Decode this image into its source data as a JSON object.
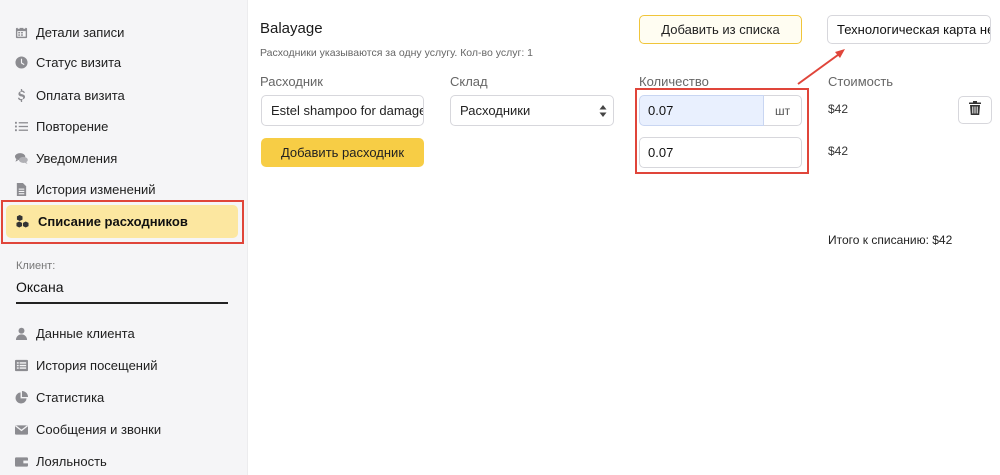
{
  "sidebar": {
    "items": [
      {
        "label": "Детали записи",
        "icon": "calendar-icon"
      },
      {
        "label": "Статус визита",
        "icon": "clock-icon"
      },
      {
        "label": "Оплата визита",
        "icon": "dollar-icon"
      },
      {
        "label": "Повторение",
        "icon": "list-icon"
      },
      {
        "label": "Уведомления",
        "icon": "comments-icon"
      },
      {
        "label": "История изменений",
        "icon": "document-icon"
      }
    ],
    "active": {
      "label": "Списание расходников",
      "icon": "cubes-icon"
    },
    "client_label": "Клиент:",
    "client_name": "Оксана",
    "client_items": [
      {
        "label": "Данные клиента",
        "icon": "user-icon"
      },
      {
        "label": "История посещений",
        "icon": "list-alt-icon"
      },
      {
        "label": "Статистика",
        "icon": "pie-chart-icon"
      },
      {
        "label": "Сообщения и звонки",
        "icon": "envelope-icon"
      },
      {
        "label": "Лояльность",
        "icon": "wallet-icon"
      }
    ]
  },
  "main": {
    "title": "Balayage",
    "subtitle": "Расходники указываются за одну услугу. Кол-во услуг: 1",
    "add_from_list": "Добавить из списка",
    "tech_card": "Технологическая карта не",
    "columns": {
      "consumable": "Расходник",
      "warehouse": "Склад",
      "quantity": "Количество",
      "cost": "Стоимость"
    },
    "row": {
      "consumable": "Estel shampoo for damaged hair",
      "warehouse": "Расходники",
      "quantity": "0.07",
      "unit": "шт",
      "cost": "$42"
    },
    "total_quantity": "0.07",
    "total_cost": "$42",
    "add_consumable": "Добавить расходник",
    "total_writeoff": "Итого к списанию: $42"
  },
  "colors": {
    "accent_yellow": "#f7cd45",
    "active_bg": "#fce7a0",
    "highlight_red": "#e0453a",
    "sidebar_bg": "#f5f5f7"
  }
}
